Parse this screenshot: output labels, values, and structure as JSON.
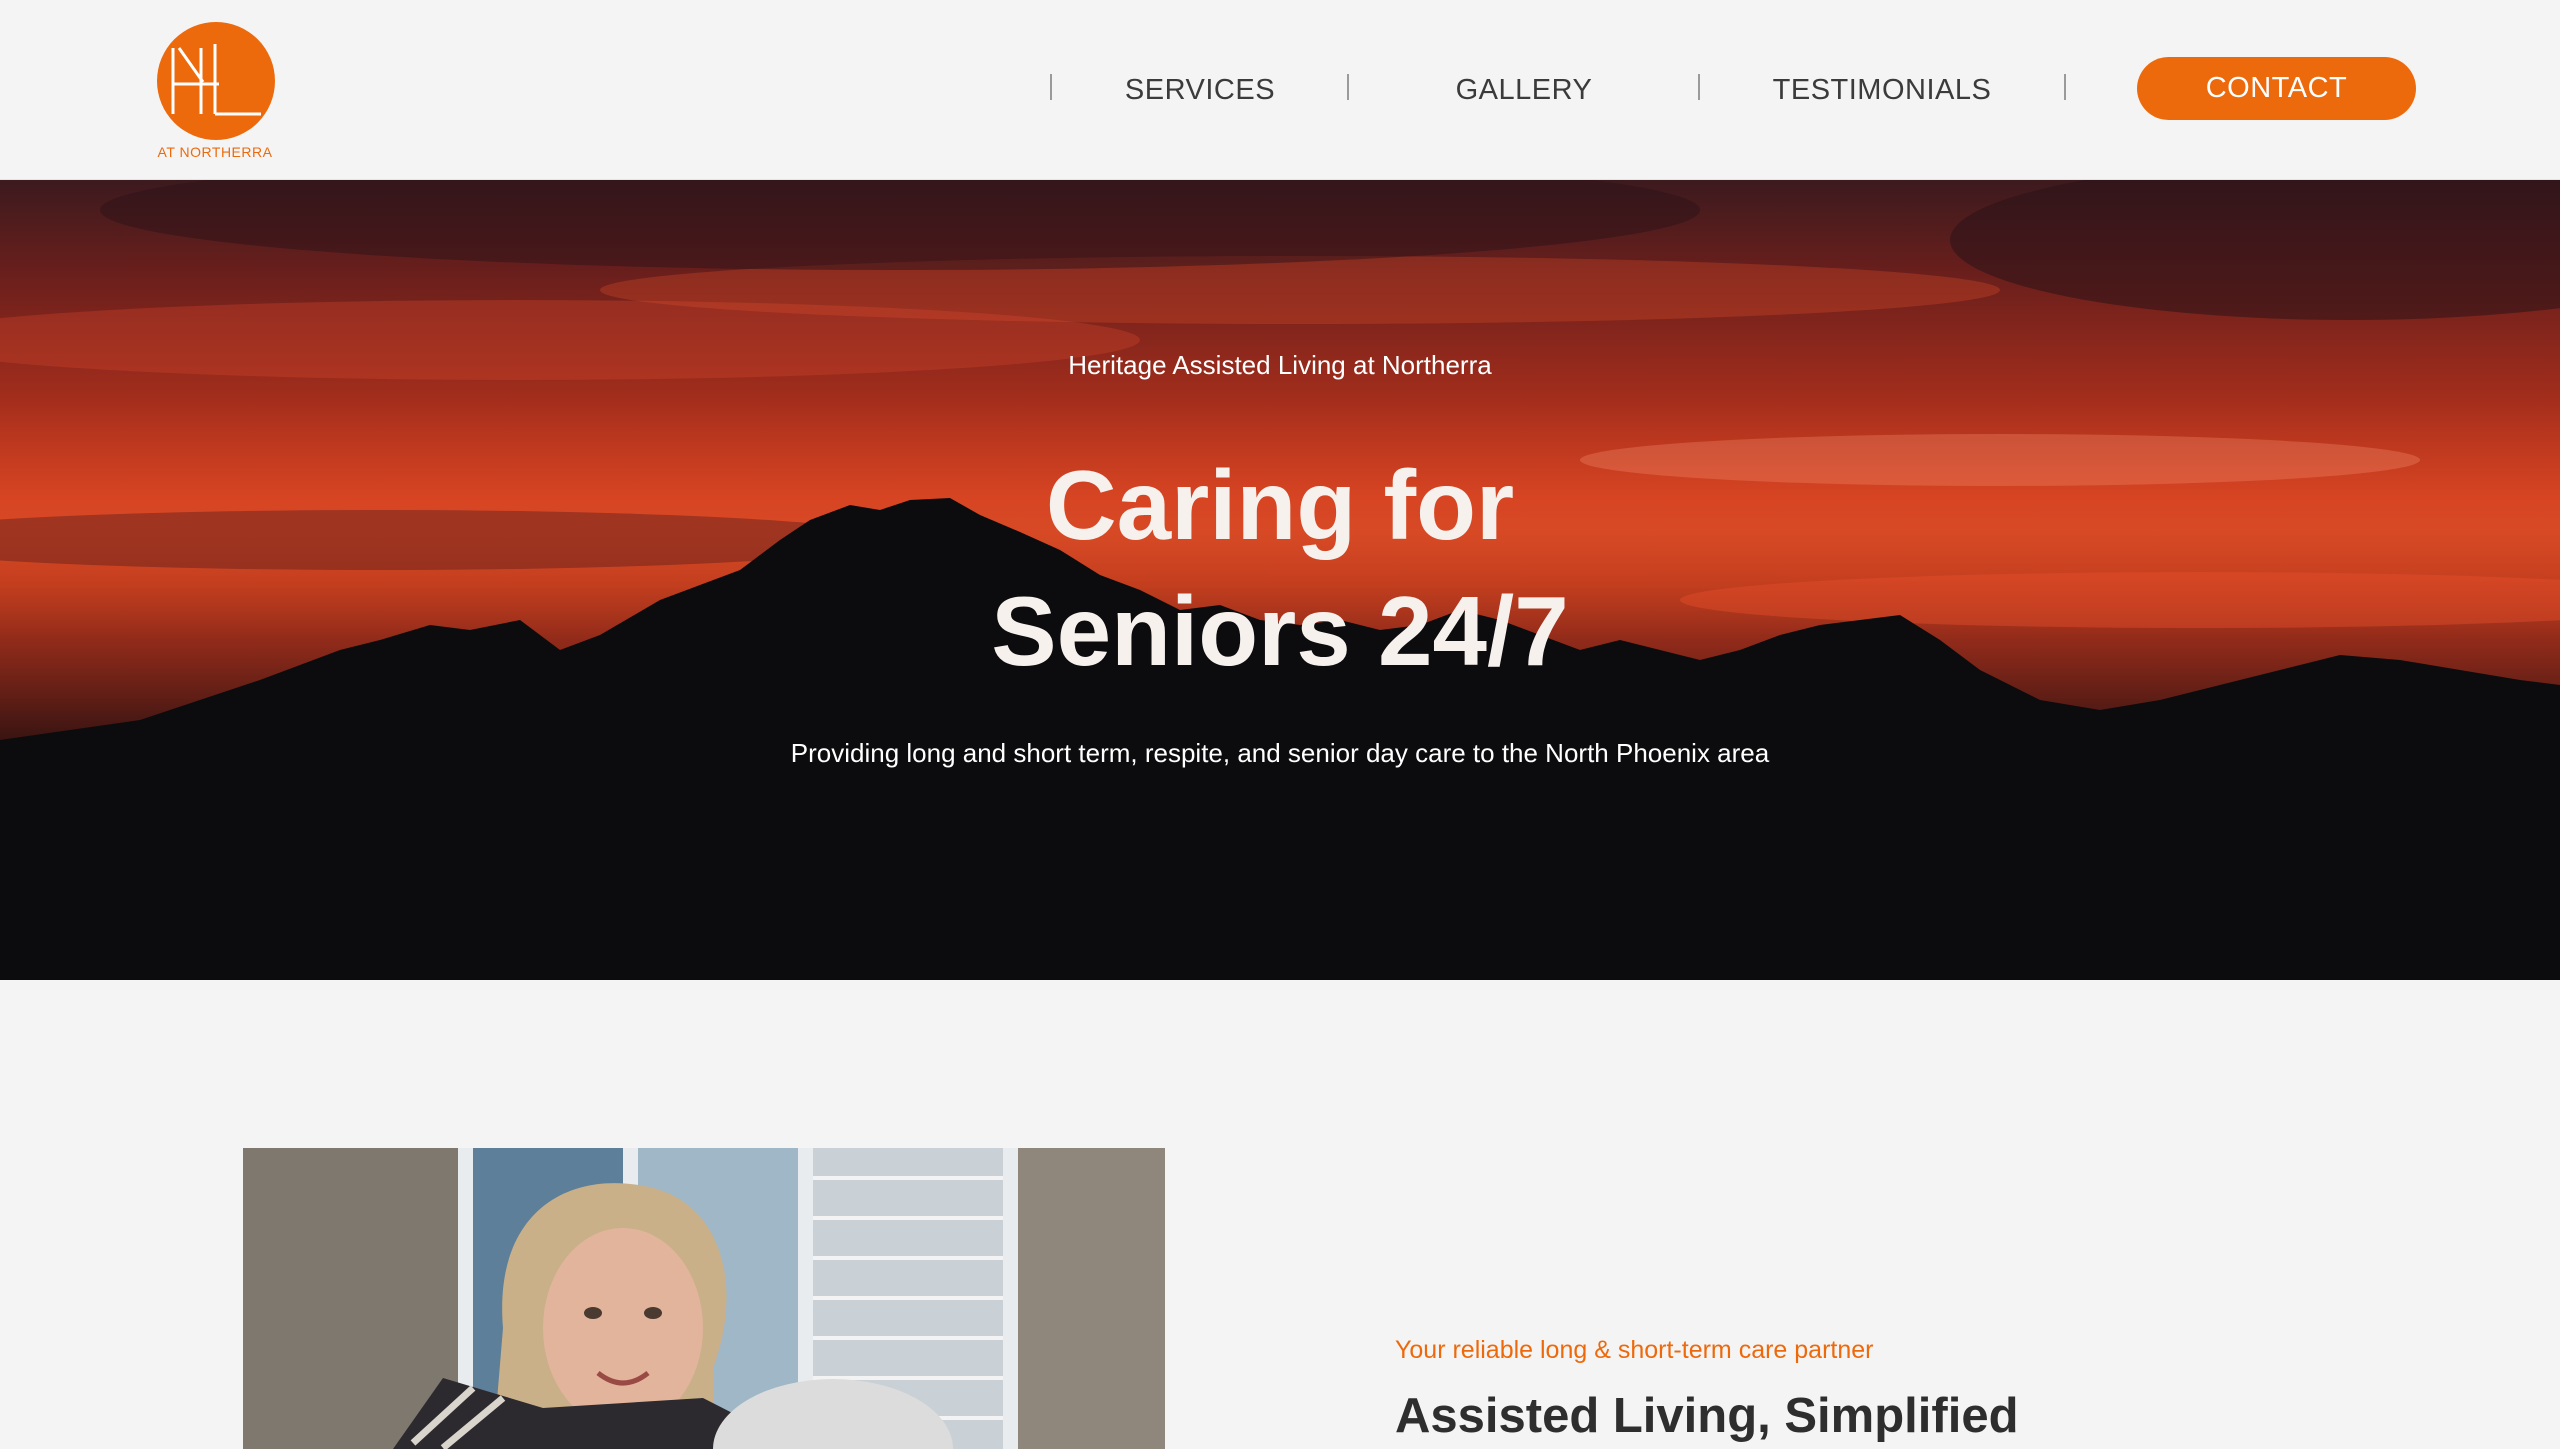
{
  "brand": {
    "logo_subtext": "AT NORTHERRA",
    "accent_color": "#ed6a0c"
  },
  "nav": {
    "items": [
      {
        "label": "SERVICES"
      },
      {
        "label": "GALLERY"
      },
      {
        "label": "TESTIMONIALS"
      }
    ],
    "contact_label": "CONTACT"
  },
  "hero": {
    "kicker": "Heritage Assisted Living at Northerra",
    "title_line1": "Caring for",
    "title_line2": "Seniors 24/7",
    "description": "Providing long and short term, respite, and senior day care to the North Phoenix area"
  },
  "intro": {
    "tagline": "Your reliable long & short-term care partner",
    "title": "Assisted Living, Simplified"
  }
}
